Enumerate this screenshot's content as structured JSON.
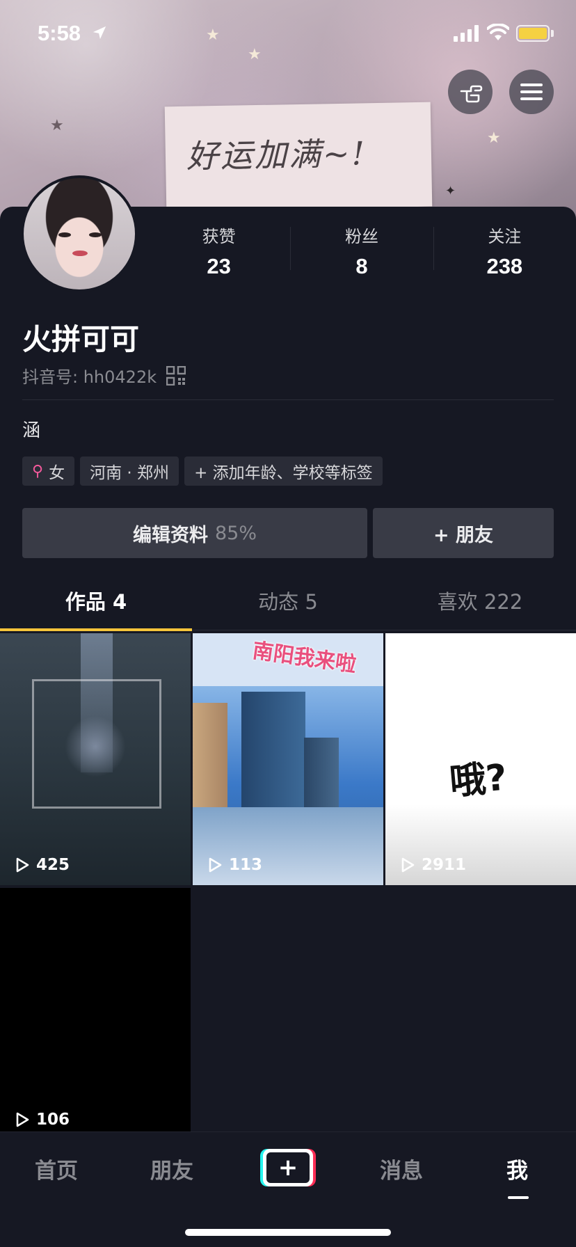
{
  "status_bar": {
    "time": "5:58"
  },
  "banner": {
    "note_text": "好运加满~!"
  },
  "profile": {
    "stats": [
      {
        "label": "获赞",
        "value": "23"
      },
      {
        "label": "粉丝",
        "value": "8"
      },
      {
        "label": "关注",
        "value": "238"
      }
    ],
    "name": "火拼可可",
    "douyin_id": "抖音号: hh0422k",
    "bio": "涵",
    "tags": {
      "gender": "女",
      "location": "河南 · 郑州",
      "add_tags": "+ 添加年龄、学校等标签"
    },
    "edit_label": "编辑资料",
    "edit_percent": "85%",
    "friend_label": "+ 朋友"
  },
  "tabs": [
    {
      "label": "作品 4"
    },
    {
      "label": "动态 5"
    },
    {
      "label": "喜欢 222"
    }
  ],
  "videos": [
    {
      "plays": "425"
    },
    {
      "plays": "113",
      "overlay_text": "南阳我来啦"
    },
    {
      "plays": "2911",
      "overlay_text": "哦?"
    },
    {
      "plays": "106"
    }
  ],
  "bottom_nav": {
    "home": "首页",
    "friends": "朋友",
    "create": "+",
    "messages": "消息",
    "me": "我"
  },
  "colors": {
    "background": "#161823",
    "accent_tab": "#f5c43a",
    "battery": "#f5d142",
    "create_cyan": "#25f4ee",
    "create_red": "#fe2c55"
  }
}
